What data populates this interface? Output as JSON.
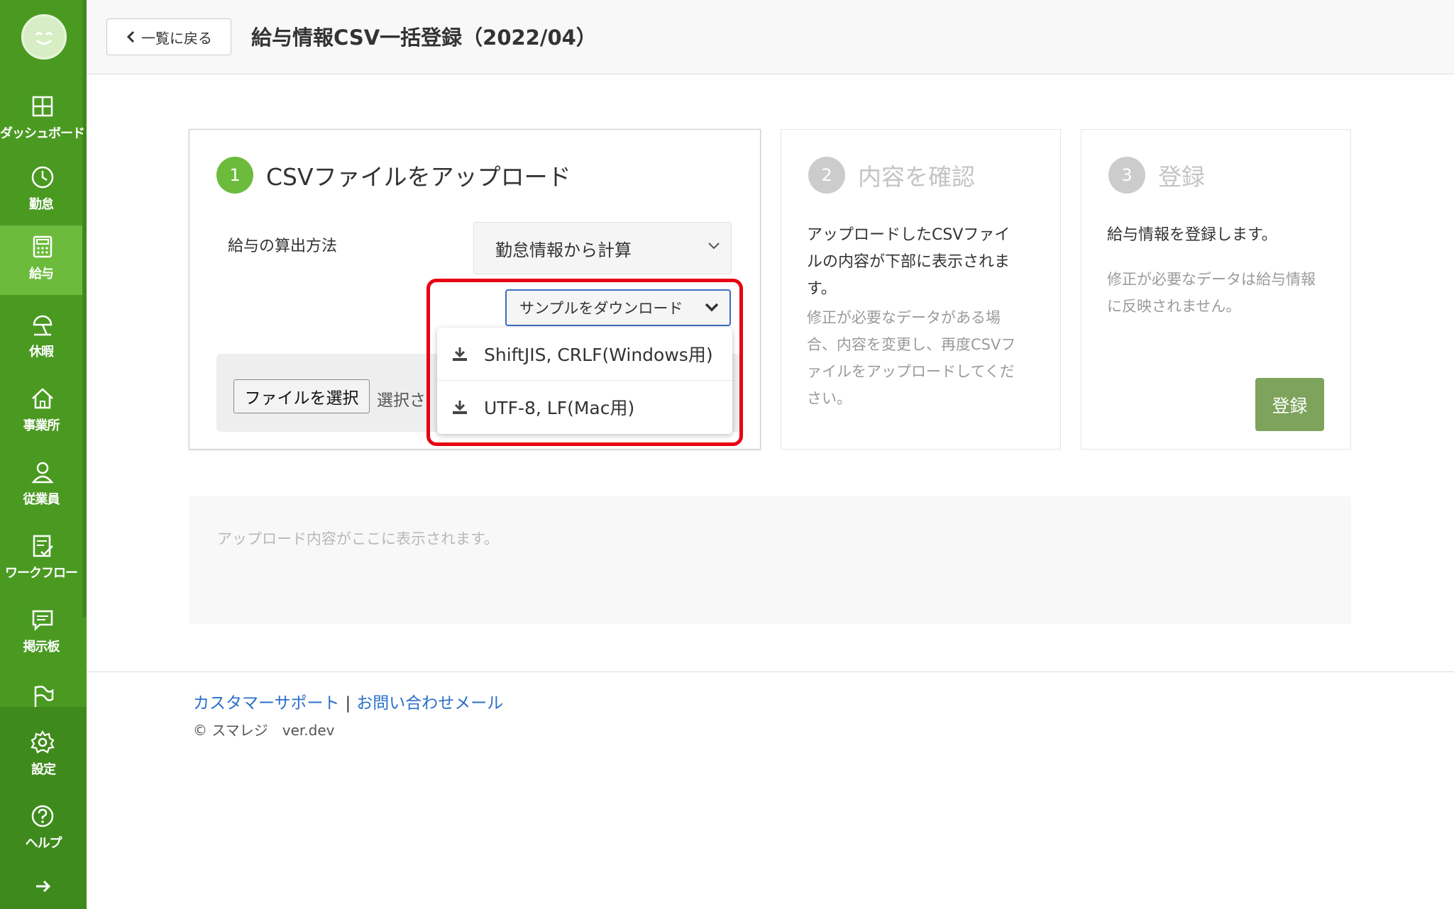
{
  "sidebar": {
    "items": [
      {
        "label": "ダッシュボード",
        "icon": "dashboard-icon"
      },
      {
        "label": "勤怠",
        "icon": "clock-icon"
      },
      {
        "label": "給与",
        "icon": "calculator-icon",
        "active": true
      },
      {
        "label": "休暇",
        "icon": "beach-umbrella-icon"
      },
      {
        "label": "事業所",
        "icon": "home-icon"
      },
      {
        "label": "従業員",
        "icon": "person-icon"
      },
      {
        "label": "ワークフロー",
        "icon": "checklist-icon"
      },
      {
        "label": "掲示板",
        "icon": "message-icon"
      }
    ],
    "bottom_items": [
      {
        "label": "設定",
        "icon": "gear-icon"
      },
      {
        "label": "ヘルプ",
        "icon": "help-icon"
      }
    ]
  },
  "header": {
    "back_label": "一覧に戻る",
    "title": "給与情報CSV一括登録（2022/04）"
  },
  "steps": {
    "step1": {
      "number": "1",
      "title": "CSVファイルをアップロード",
      "calc_label": "給与の算出方法",
      "calc_value": "勤怠情報から計算",
      "sample_button": "サンプルをダウンロード",
      "file_button": "ファイルを選択",
      "file_status": "選択さ",
      "dropdown_options": [
        "ShiftJIS, CRLF(Windows用)",
        "UTF-8, LF(Mac用)"
      ]
    },
    "step2": {
      "number": "2",
      "title": "内容を確認",
      "desc_lines": [
        "アップロードしたCSVファイ",
        "ルの内容が下部に表示されま",
        "す。"
      ],
      "note_lines": [
        "修正が必要なデータがある場",
        "合、内容を変更し、再度CSVフ",
        "ァイルをアップロードしてくだ",
        "さい。"
      ]
    },
    "step3": {
      "number": "3",
      "title": "登録",
      "desc": "給与情報を登録します。",
      "note_lines": [
        "修正が必要なデータは給与情報",
        "に反映されません。"
      ],
      "button": "登録"
    }
  },
  "upload_placeholder": "アップロード内容がここに表示されます。",
  "footer": {
    "support_link": "カスタマーサポート",
    "separator": "|",
    "mail_link": "お問い合わせメール",
    "copyright": "© スマレジ　ver.dev"
  },
  "colors": {
    "sidebar": "#4a9a22",
    "active": "#6cbb3c",
    "highlight": "#e60012",
    "register_button": "#7da35c"
  }
}
